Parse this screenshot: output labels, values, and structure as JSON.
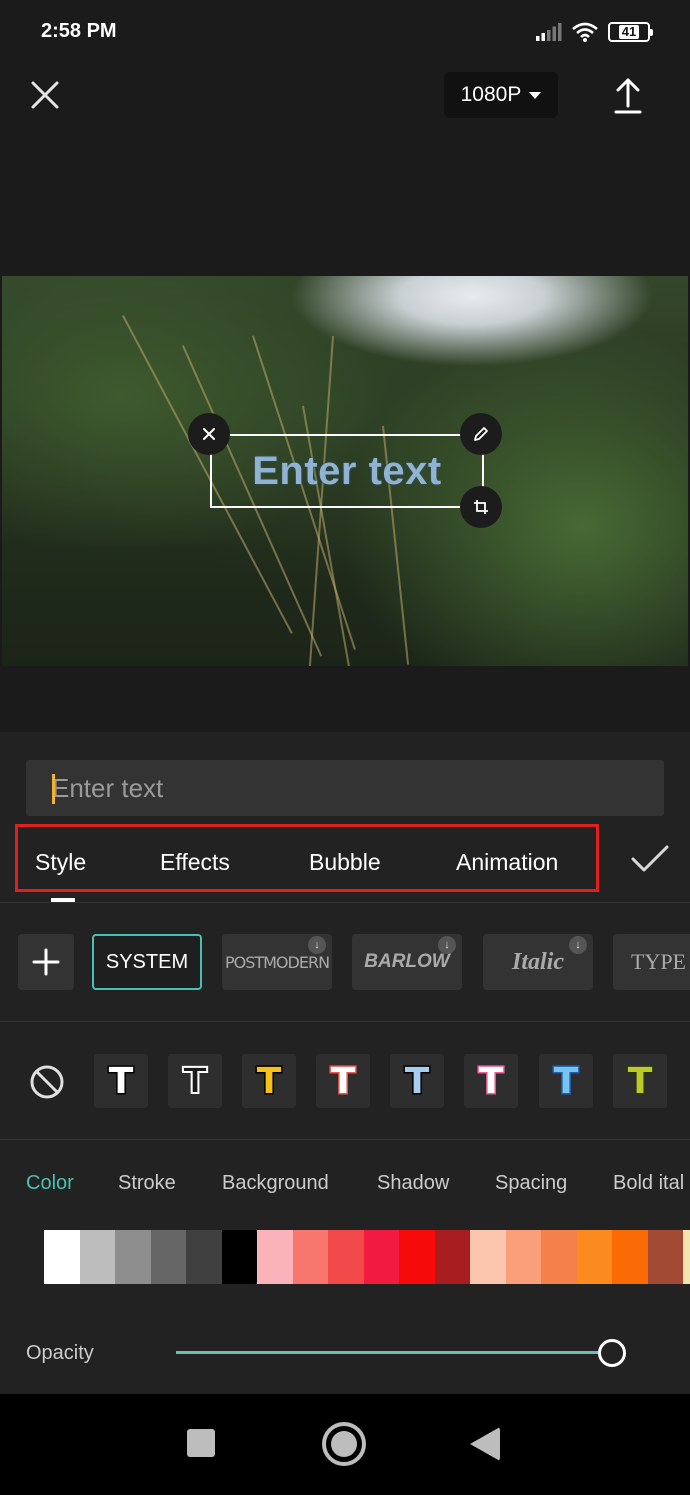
{
  "status_bar": {
    "time": "2:58 PM",
    "battery": "41",
    "icons": [
      "signal-icon",
      "wifi-icon",
      "battery-icon"
    ]
  },
  "top_bar": {
    "resolution": "1080P",
    "icons": [
      "close-icon",
      "caret-down-icon",
      "export-upload-icon"
    ]
  },
  "preview": {
    "overlay_text": "Enter text",
    "handle_icons": [
      "close-icon",
      "pencil-icon",
      "resize-rotate-icon"
    ]
  },
  "editor": {
    "input_placeholder": "Enter text",
    "tabs": [
      "Style",
      "Effects",
      "Bubble",
      "Animation"
    ],
    "active_tab": "Style",
    "confirm_icon": "checkmark-icon",
    "fonts": {
      "add_icon": "plus-icon",
      "items": [
        {
          "label": "SYSTEM",
          "selected": true
        },
        {
          "label": "POSTMODERN",
          "downloadable": true
        },
        {
          "label": "BARLOW",
          "downloadable": true
        },
        {
          "label": "Italic",
          "downloadable": true
        },
        {
          "label": "TYPE",
          "downloadable": false
        }
      ]
    },
    "presets": {
      "none_icon": "no-style-icon",
      "items": [
        {
          "letter": "T",
          "fill": "#ffffff",
          "stroke": "#000000"
        },
        {
          "letter": "T",
          "fill": "#1b1b1b",
          "stroke": "#ffffff"
        },
        {
          "letter": "T",
          "fill": "#f6c21a",
          "stroke": "#000000"
        },
        {
          "letter": "T",
          "fill": "#ffffff",
          "stroke": "#e8564f"
        },
        {
          "letter": "T",
          "fill": "#a9cdf0",
          "stroke": "#000000"
        },
        {
          "letter": "T",
          "fill": "#ffffff",
          "stroke": "#f25a9c"
        },
        {
          "letter": "T",
          "fill": "#78c4f0",
          "stroke": "#1e5fa8"
        },
        {
          "letter": "T",
          "fill": "#b9cc2a",
          "stroke": "#2d3410"
        }
      ]
    },
    "subtabs": [
      "Color",
      "Stroke",
      "Background",
      "Shadow",
      "Spacing",
      "Bold ital"
    ],
    "active_subtab": "Color",
    "palette": [
      "#ffffff",
      "#bdbdbd",
      "#8e8e8e",
      "#666666",
      "#404040",
      "#000000",
      "#fbb3bb",
      "#f7766e",
      "#f24a4a",
      "#f21a40",
      "#f60a0a",
      "#a81d20",
      "#fbc6ad",
      "#fa9f7a",
      "#f4804b",
      "#fb8a1f",
      "#fa6a07",
      "#a24a34",
      "#f5e3b0"
    ],
    "opacity_label": "Opacity",
    "opacity_value": 1.0
  },
  "nav_bar": {
    "icons": [
      "recent-apps-icon",
      "home-icon",
      "back-icon"
    ]
  }
}
